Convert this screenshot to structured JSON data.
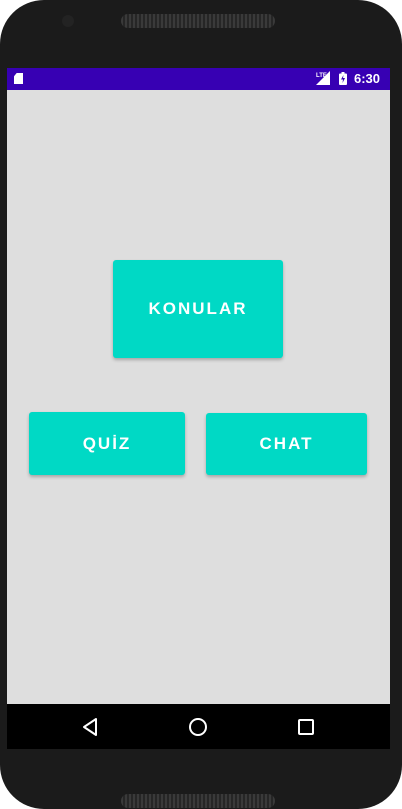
{
  "status_bar": {
    "time": "6:30",
    "background_color": "#3700b3",
    "icons": [
      "sd-card-icon",
      "lte-signal-icon",
      "battery-charging-icon"
    ]
  },
  "main": {
    "background_color": "#dedede",
    "button_color": "#00d9c5",
    "buttons": {
      "konular": "KONULAR",
      "quiz": "QUİZ",
      "chat": "CHAT"
    }
  },
  "nav_bar": {
    "icons": [
      "back-icon",
      "home-icon",
      "recents-icon"
    ]
  }
}
